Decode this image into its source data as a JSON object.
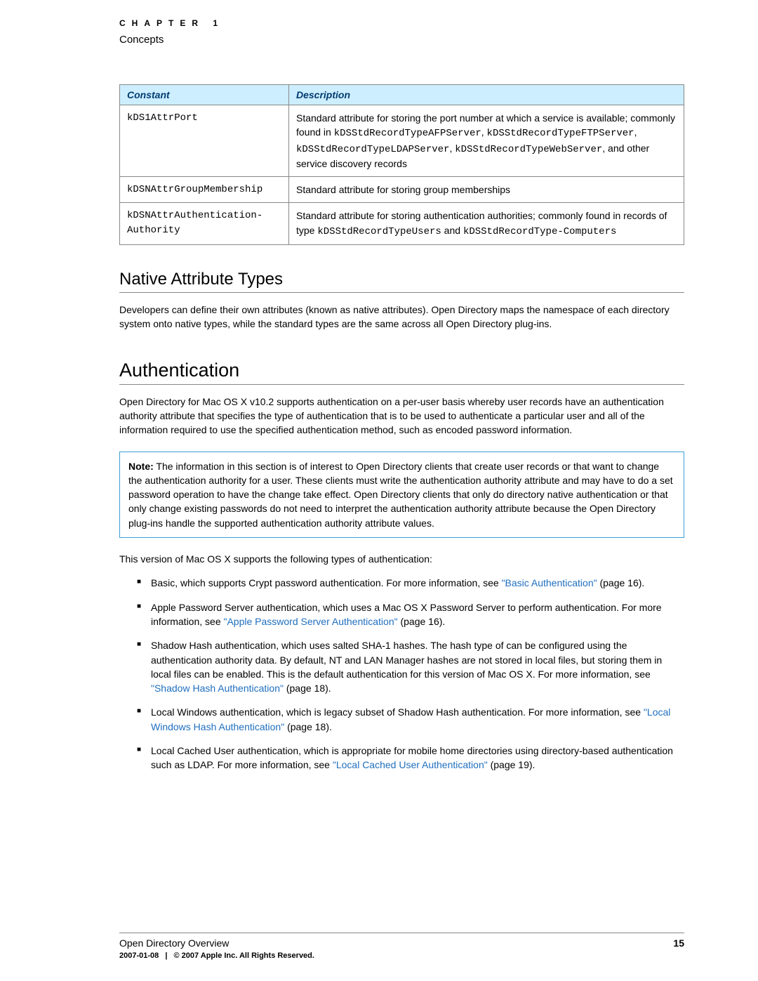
{
  "header": {
    "chapter_label": "CHAPTER 1",
    "concepts": "Concepts"
  },
  "table": {
    "headers": {
      "constant": "Constant",
      "description": "Description"
    },
    "rows": [
      {
        "constant": "kDS1AttrPort",
        "desc_pre": "Standard attribute for storing the port number at which a service is available; commonly found in ",
        "code1": "kDSStdRecordTypeAFPServer",
        "sep1": ", ",
        "code2": "kDSStdRecordTypeFTPServer",
        "sep2": ", ",
        "code3": "kDSStdRecordTypeLDAPServer",
        "sep3": ", ",
        "code4": "kDSStdRecordTypeWebServer",
        "desc_post": ", and other service discovery records"
      },
      {
        "constant": "kDSNAttrGroupMembership",
        "desc": "Standard attribute for storing group memberships"
      },
      {
        "constant": "kDSNAttrAuthentication-Authority",
        "desc_pre": "Standard attribute for storing authentication authorities; commonly found in records of type ",
        "code1": "kDSStdRecordTypeUsers",
        "sep1": " and ",
        "code2": "kDSStdRecordType-Computers"
      }
    ]
  },
  "sections": {
    "native_title": "Native Attribute Types",
    "native_body": "Developers can define their own attributes (known as native attributes). Open Directory maps the namespace of each directory system onto native types, while the standard types are the same across all Open Directory plug-ins.",
    "auth_title": "Authentication",
    "auth_body": "Open Directory for Mac OS X v10.2 supports authentication on a per-user basis whereby user records have an authentication authority attribute that specifies the type of authentication that is to be used to authenticate a particular user and all of the information required to use the specified authentication method, such as encoded password information.",
    "note_label": "Note:",
    "note_body": " The information in this section is of interest to Open Directory clients that create user records or that want to change the authentication authority for a user. These clients must write the authentication authority attribute and may have to do a set password operation to have the change take effect. Open Directory clients that only do directory native authentication or that only change existing passwords do not need to interpret the authentication authority attribute because the Open Directory plug-ins handle the supported authentication authority attribute values.",
    "auth_list_intro": "This version of Mac OS X supports the following types of authentication:"
  },
  "bullets": [
    {
      "pre": "Basic, which supports Crypt password authentication. For more information, see ",
      "link": "\"Basic Authentication\"",
      "post": " (page 16)."
    },
    {
      "pre": "Apple Password Server authentication, which uses a Mac OS X Password Server to perform authentication. For more information, see ",
      "link": "\"Apple Password Server Authentication\"",
      "post": " (page 16)."
    },
    {
      "pre": "Shadow Hash authentication, which uses salted SHA-1 hashes. The hash type of can be configured using the authentication authority data. By default, NT and LAN Manager hashes are not stored in local files, but storing them in local files can be enabled. This is the default authentication for this version of Mac OS X. For more information, see ",
      "link": "\"Shadow Hash Authentication\"",
      "post": " (page 18)."
    },
    {
      "pre": "Local Windows authentication, which is legacy subset of Shadow Hash authentication. For more information, see ",
      "link": "\"Local Windows Hash Authentication\"",
      "post": " (page 18)."
    },
    {
      "pre": "Local Cached User authentication, which is appropriate for mobile home directories using directory-based authentication such as LDAP. For more information, see ",
      "link": "\"Local Cached User Authentication\"",
      "post": " (page 19)."
    }
  ],
  "footer": {
    "title": "Open Directory Overview",
    "page": "15",
    "date": "2007-01-08",
    "sep": "|",
    "copyright": "© 2007 Apple Inc. All Rights Reserved."
  }
}
